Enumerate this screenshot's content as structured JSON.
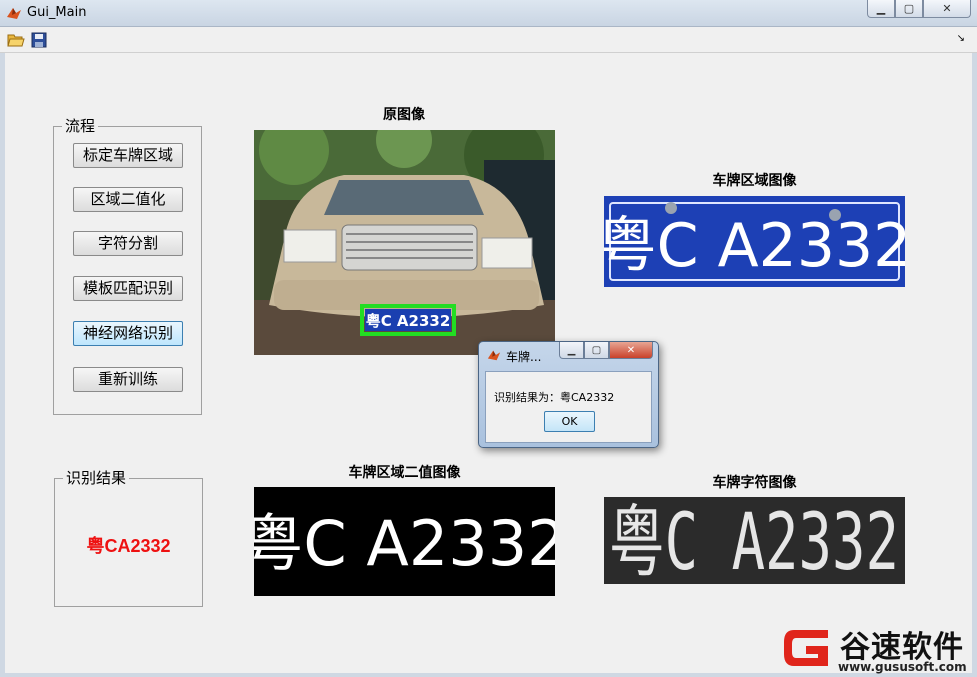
{
  "window": {
    "title": "Gui_Main"
  },
  "toolbar": {
    "open_icon": "open-folder-icon",
    "save_icon": "save-icon"
  },
  "process_panel": {
    "title": "流程",
    "buttons": [
      "标定车牌区域",
      "区域二值化",
      "字符分割",
      "模板匹配识别",
      "神经网络识别",
      "重新训练"
    ]
  },
  "result_panel": {
    "title": "识别结果",
    "value": "粤CA2332",
    "value_color": "#ee1111"
  },
  "images": {
    "original_caption": "原图像",
    "plate_region_caption": "车牌区域图像",
    "binary_caption": "车牌区域二值图像",
    "chars_caption": "车牌字符图像",
    "plate_text": "粤C A2332",
    "plate_color": "#1a3fb0"
  },
  "dialog": {
    "title": "车牌...",
    "message": "识别结果为：粤CA2332",
    "ok_label": "OK"
  },
  "watermark": {
    "brand": "谷速软件",
    "url": "www.gususoft.com",
    "accent": "#e0251b"
  }
}
